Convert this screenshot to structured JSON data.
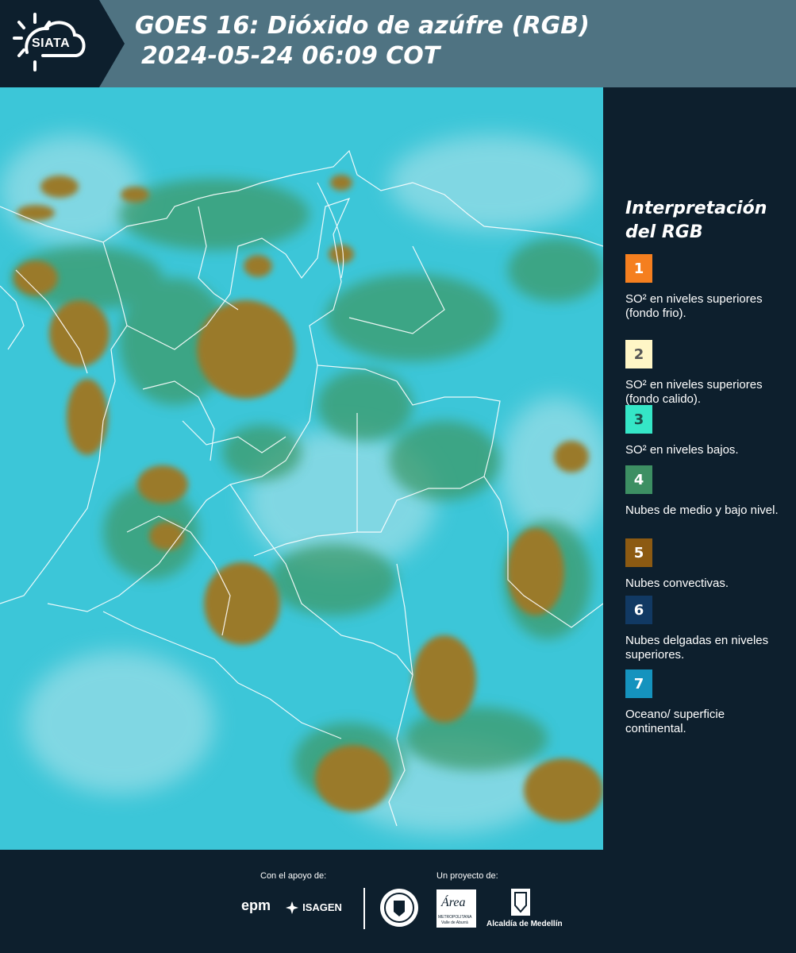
{
  "header": {
    "logo_text": "SIATA",
    "title_line1": "GOES 16: Dióxido de azúfre (RGB)",
    "title_line2": "2024-05-24 06:09 COT"
  },
  "legend": {
    "title_line1": "Interpretación",
    "title_line2": "del RGB",
    "items": [
      {
        "num": "1",
        "color": "#f57f1f",
        "num_color": "#ffffff",
        "text": "SO² en niveles superiores (fondo frio)."
      },
      {
        "num": "2",
        "color": "#fff6c6",
        "num_color": "#555555",
        "text": "SO² en niveles superiores (fondo calido)."
      },
      {
        "num": "3",
        "color": "#35e6c7",
        "num_color": "#1d4e4a",
        "text": "SO² en niveles bajos."
      },
      {
        "num": "4",
        "color": "#3d8f63",
        "num_color": "#ffffff",
        "text": "Nubes de medio y bajo nivel."
      },
      {
        "num": "5",
        "color": "#8c5a12",
        "num_color": "#ffffff",
        "text": "Nubes convectivas."
      },
      {
        "num": "6",
        "color": "#113963",
        "num_color": "#ffffff",
        "text": "Nubes delgadas en niveles superiores."
      },
      {
        "num": "7",
        "color": "#1593be",
        "num_color": "#ffffff",
        "text": "Oceano/ superficie continental."
      }
    ]
  },
  "footer": {
    "support_label": "Con el apoyo de:",
    "project_label": "Un proyecto de:",
    "epm": "epm",
    "isagen": "ISAGEN",
    "area_name": "Área",
    "area_sub1": "METROPOLITANA",
    "area_sub2": "Valle de Aburrá",
    "alcaldia": "Alcaldía de Medellín"
  },
  "colors": {
    "background": "#0d1f2d",
    "header": "#4f7382",
    "ocean_cyan": "#3cc6d8",
    "cloud_brown": "#9a7a2a",
    "cloud_green": "#3e9a6a"
  }
}
